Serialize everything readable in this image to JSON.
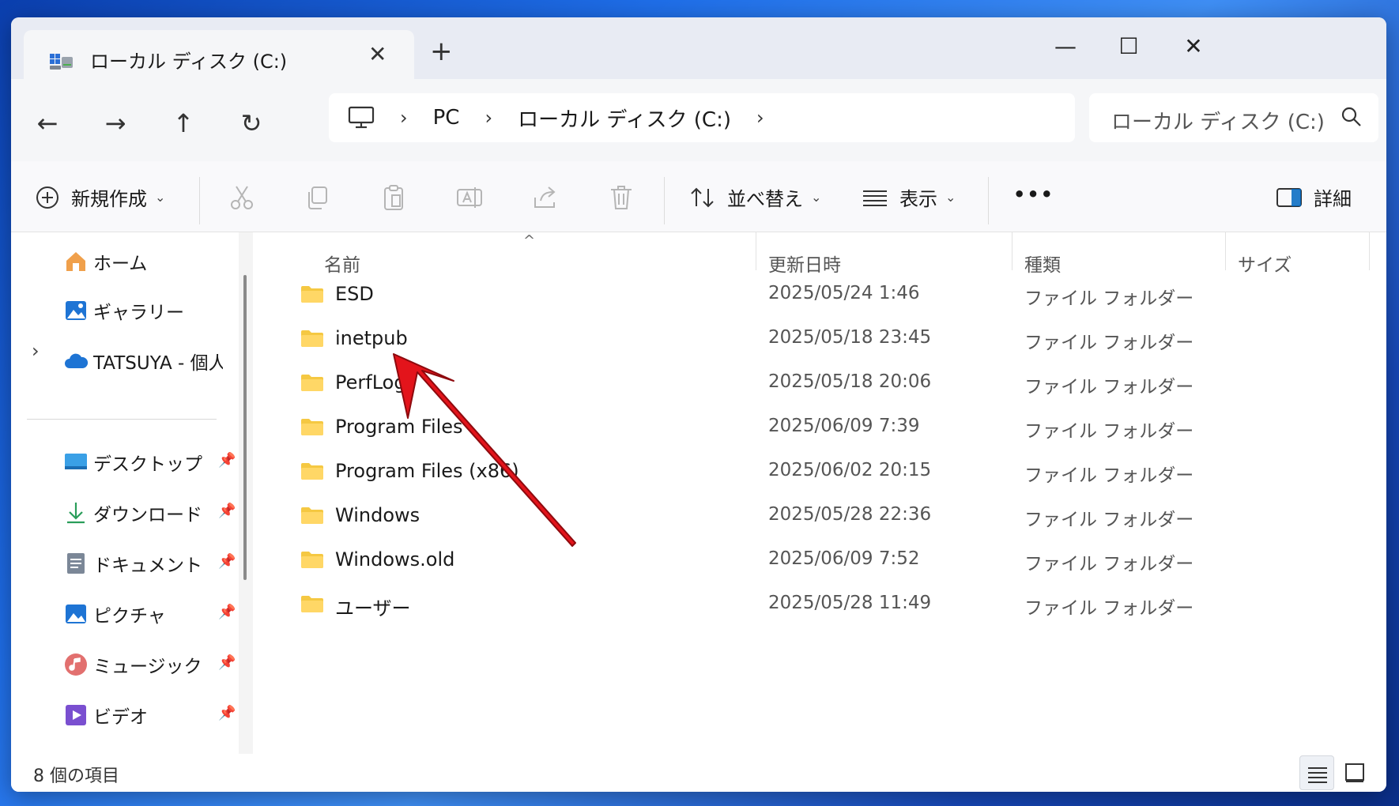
{
  "tab": {
    "title": "ローカル ディスク (C:)",
    "close": "✕",
    "new_tab": "+"
  },
  "window_controls": {
    "minimize": "—",
    "maximize": "☐",
    "close": "✕"
  },
  "nav": {
    "back": "←",
    "forward": "→",
    "up": "↑",
    "refresh": "↻"
  },
  "address": {
    "sep": "›",
    "items": [
      "PC",
      "ローカル ディスク (C:)"
    ]
  },
  "search": {
    "text": "ローカル ディスク (C:)の検索"
  },
  "toolbar": {
    "new_label": "新規作成",
    "sort_label": "並べ替え",
    "view_label": "表示",
    "more_label": "•••",
    "details_label": "詳細",
    "chevron": "⌄"
  },
  "sidebar": {
    "home": "ホーム",
    "gallery": "ギャラリー",
    "onedrive": "TATSUYA - 個人用",
    "expand": "›",
    "pin": "📌",
    "quick": [
      "デスクトップ",
      "ダウンロード",
      "ドキュメント",
      "ピクチャ",
      "ミュージック",
      "ビデオ"
    ]
  },
  "columns": {
    "name": "名前",
    "date": "更新日時",
    "type": "種類",
    "size": "サイズ",
    "sort_caret": "^"
  },
  "files": [
    {
      "name": "ESD",
      "date": "2025/05/24 1:46",
      "type": "ファイル フォルダー"
    },
    {
      "name": "inetpub",
      "date": "2025/05/18 23:45",
      "type": "ファイル フォルダー"
    },
    {
      "name": "PerfLogs",
      "date": "2025/05/18 20:06",
      "type": "ファイル フォルダー"
    },
    {
      "name": "Program Files",
      "date": "2025/06/09 7:39",
      "type": "ファイル フォルダー"
    },
    {
      "name": "Program Files (x86)",
      "date": "2025/06/02 20:15",
      "type": "ファイル フォルダー"
    },
    {
      "name": "Windows",
      "date": "2025/05/28 22:36",
      "type": "ファイル フォルダー"
    },
    {
      "name": "Windows.old",
      "date": "2025/06/09 7:52",
      "type": "ファイル フォルダー"
    },
    {
      "name": "ユーザー",
      "date": "2025/05/28 11:49",
      "type": "ファイル フォルダー"
    }
  ],
  "status": {
    "count": "8 個の項目"
  },
  "colors": {
    "folder": "#f5c842",
    "accent": "#0067c0",
    "annotation_arrow": "#e3141b"
  }
}
